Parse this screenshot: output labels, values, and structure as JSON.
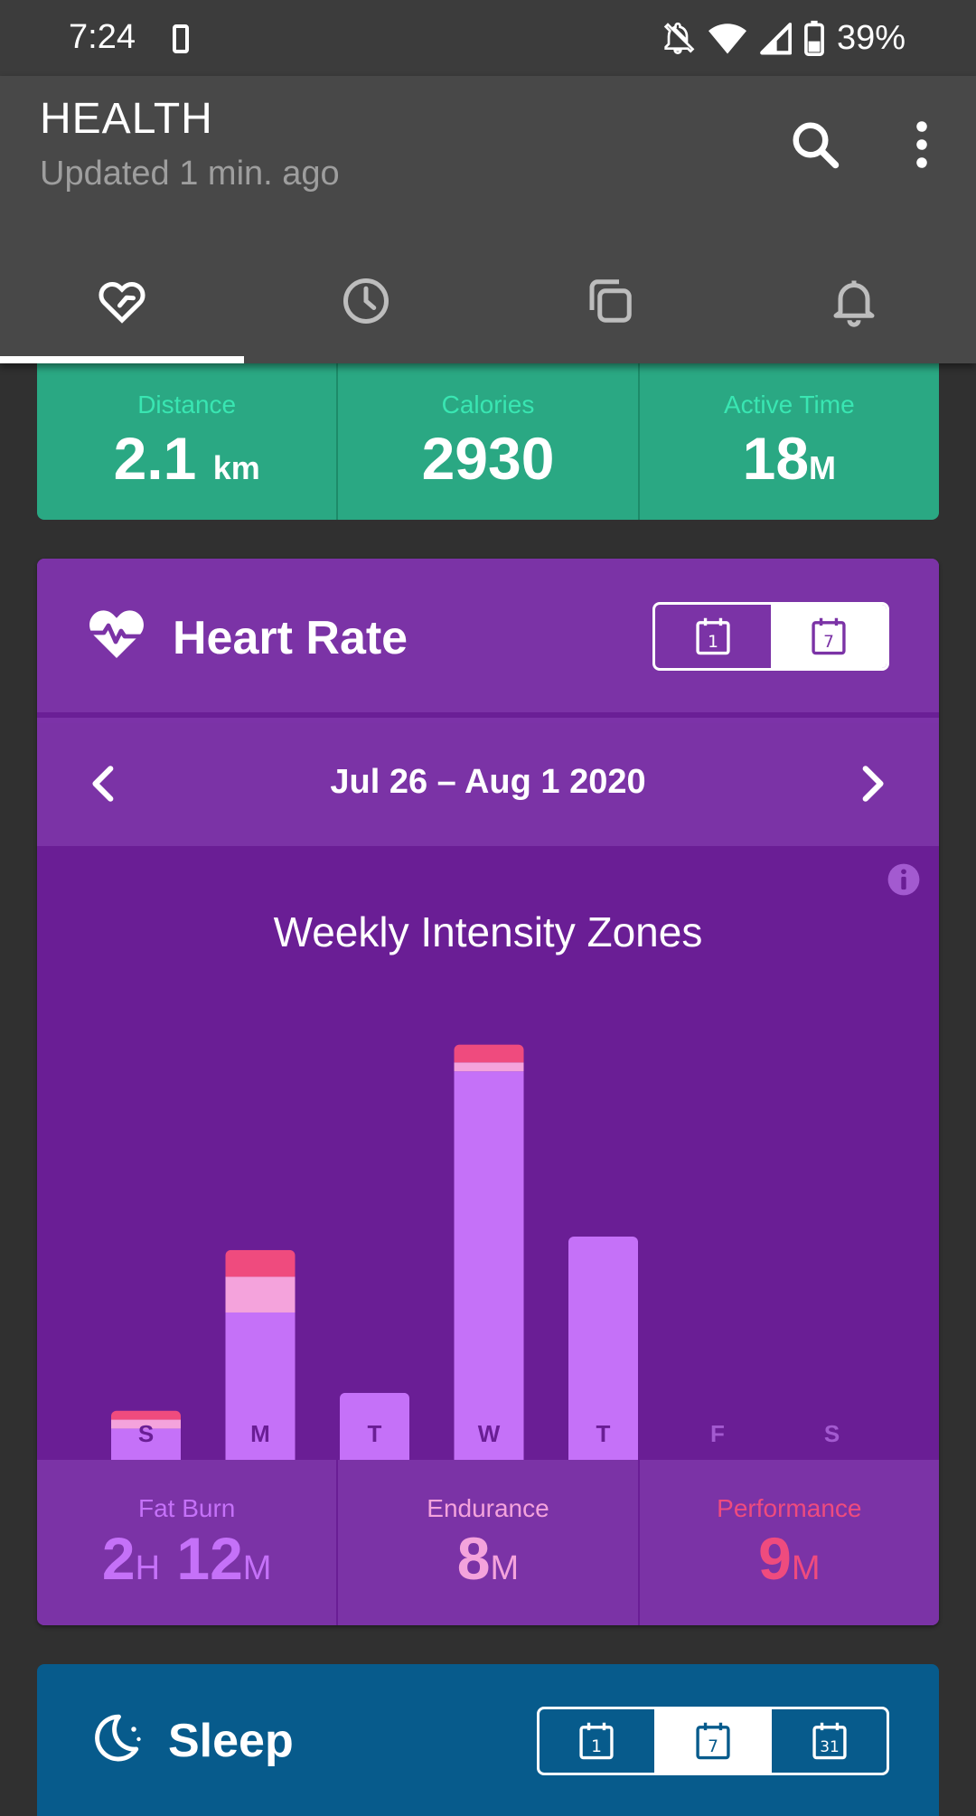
{
  "status_bar": {
    "time": "7:24",
    "battery": "39%"
  },
  "app_bar": {
    "title": "HEALTH",
    "subtitle": "Updated 1 min. ago",
    "tabs": [
      {
        "icon": "heart-check-icon",
        "active": true
      },
      {
        "icon": "clock-icon",
        "active": false
      },
      {
        "icon": "copy-icon",
        "active": false
      },
      {
        "icon": "bell-icon",
        "active": false
      }
    ]
  },
  "summary": {
    "distance_label": "Distance",
    "distance_value": "2.1",
    "distance_unit": "km",
    "calories_label": "Calories",
    "calories_value": "2930",
    "active_label": "Active Time",
    "active_value": "18",
    "active_unit": "M"
  },
  "heart_rate": {
    "title": "Heart Rate",
    "range_buttons": [
      "1",
      "7"
    ],
    "active_range": "7",
    "date_range": "Jul 26 – Aug 1 2020"
  },
  "chart_data": {
    "type": "bar",
    "stacked": true,
    "title": "Weekly Intensity Zones",
    "categories": [
      "S",
      "M",
      "T",
      "W",
      "T",
      "F",
      "S"
    ],
    "series": [
      {
        "name": "Fat Burn",
        "color": "#c571f8",
        "values": [
          7,
          33,
          15,
          87,
          50,
          0,
          0
        ]
      },
      {
        "name": "Endurance",
        "color": "#f4a3dc",
        "values": [
          2,
          8,
          0,
          2,
          0,
          0,
          0
        ]
      },
      {
        "name": "Performance",
        "color": "#ef4b7e",
        "values": [
          2,
          6,
          0,
          4,
          0,
          0,
          0
        ]
      }
    ],
    "ylim": [
      0,
      100
    ]
  },
  "zones": {
    "fat_burn": {
      "label": "Fat Burn",
      "h": "2",
      "h_unit": "H",
      "m": "12",
      "m_unit": "M",
      "color": "#c571f8"
    },
    "endurance": {
      "label": "Endurance",
      "m": "8",
      "m_unit": "M",
      "color": "#f4a3dc"
    },
    "performance": {
      "label": "Performance",
      "m": "9",
      "m_unit": "M",
      "color": "#ef4b7e"
    }
  },
  "sleep": {
    "title": "Sleep",
    "range_buttons": [
      "1",
      "7",
      "31"
    ],
    "active_range": "7"
  }
}
